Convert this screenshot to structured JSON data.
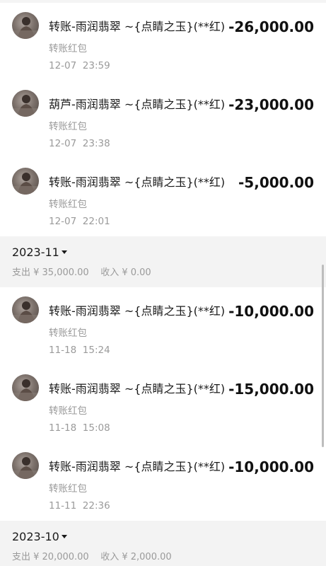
{
  "transactions_top": [
    {
      "title": "转账-雨润翡翠 ~{点睛之玉}(**红)",
      "type": "转账红包",
      "time": "12-07  23:59",
      "amount": "-26,000.00"
    },
    {
      "title": "葫芦-雨润翡翠 ~{点睛之玉}(**红)",
      "type": "转账红包",
      "time": "12-07  23:38",
      "amount": "-23,000.00"
    },
    {
      "title": "转账-雨润翡翠 ~{点睛之玉}(**红)",
      "type": "转账红包",
      "time": "12-07  22:01",
      "amount": "-5,000.00"
    }
  ],
  "month_nov": {
    "label": "2023-11",
    "summary": "支出 ¥ 35,000.00    收入 ¥ 0.00",
    "transactions": [
      {
        "title": "转账-雨润翡翠 ~{点睛之玉}(**红)",
        "type": "转账红包",
        "time": "11-18  15:24",
        "amount": "-10,000.00"
      },
      {
        "title": "转账-雨润翡翠 ~{点睛之玉}(**红)",
        "type": "转账红包",
        "time": "11-18  15:08",
        "amount": "-15,000.00"
      },
      {
        "title": "转账-雨润翡翠 ~{点睛之玉}(**红)",
        "type": "转账红包",
        "time": "11-11  22:36",
        "amount": "-10,000.00"
      }
    ]
  },
  "month_oct": {
    "label": "2023-10",
    "summary": "支出 ¥ 20,000.00    收入 ¥ 2,000.00"
  }
}
